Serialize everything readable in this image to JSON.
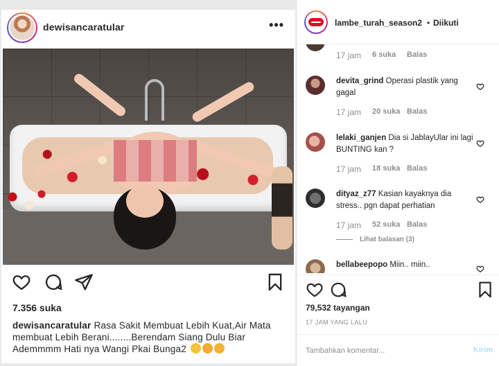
{
  "left_post": {
    "username": "dewisancaratular",
    "likes": "7.356 suka",
    "caption_user": "dewisancaratular",
    "caption_text": "Rasa Sakit Membuat Lebih Kuat,Air Mata membuat Lebih Berani........Berendam Siang Dulu Biar Ademmmm Hati nya Wangi Pkai Bunga2",
    "icons": [
      "heart-outline-icon",
      "comment-icon",
      "share-icon",
      "bookmark-icon",
      "more-options-icon"
    ]
  },
  "right_panel": {
    "username": "lambe_turah_season2",
    "separator": "•",
    "follow_status": "Diikuti",
    "comments": [
      {
        "user": "",
        "text": "",
        "time": "17 jam",
        "likes": "6 suka",
        "reply": "Balas"
      },
      {
        "user": "devita_grind",
        "text": "Operasi plastik yang gagal",
        "time": "17 jam",
        "likes": "20 suka",
        "reply": "Balas"
      },
      {
        "user": "lelaki_ganjen",
        "text": "Dia si JablayUlar ini lagi BUNTING kan ?",
        "time": "17 jam",
        "likes": "18 suka",
        "reply": "Balas"
      },
      {
        "user": "dityaz_z77",
        "text": "Kasian kayaknya dia stress.. pgn dapat perhatian",
        "time": "17 jam",
        "likes": "52 suka",
        "reply": "Balas",
        "view_replies": "Lihat balasan (3)"
      },
      {
        "user": "bellabeepopo",
        "text": "Miin.. miin..",
        "time": "",
        "likes": "",
        "reply": ""
      }
    ],
    "views": "79,532 tayangan",
    "date": "17 JAM YANG LALU",
    "comment_placeholder": "Tambahkan komentar...",
    "send_label": "Kirim"
  }
}
